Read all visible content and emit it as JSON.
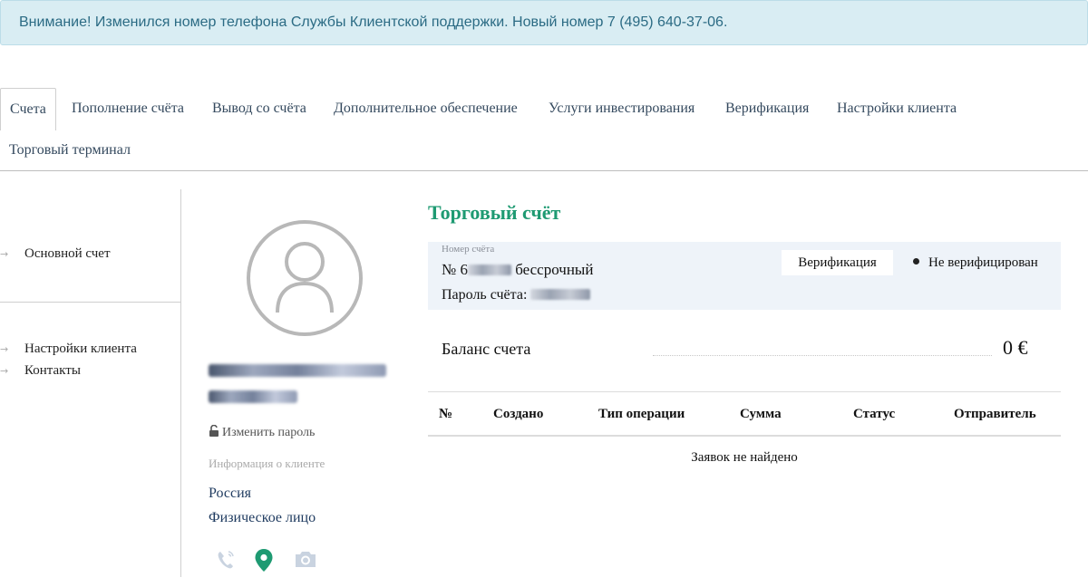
{
  "alert": {
    "text": "Внимание! Изменился номер телефона Службы Клиентской поддержки. Новый номер 7 (495) 640-37-06."
  },
  "tabs": [
    {
      "label": "Счета",
      "active": true
    },
    {
      "label": "Пополнение счёта"
    },
    {
      "label": "Вывод со счёта"
    },
    {
      "label": "Дополнительное обеспечение"
    },
    {
      "label": "Услуги инвестирования"
    },
    {
      "label": "Верификация"
    },
    {
      "label": "Настройки клиента"
    },
    {
      "label": "Торговый терминал"
    }
  ],
  "sidebar": {
    "items": [
      {
        "label": "Основной счет"
      },
      {
        "label": "Настройки клиента"
      },
      {
        "label": "Контакты"
      }
    ]
  },
  "profile": {
    "change_password": "Изменить пароль",
    "info_label": "Информация о клиенте",
    "country": "Россия",
    "client_type": "Физическое лицо",
    "icons": [
      "phone-icon",
      "location-pin-icon",
      "camera-icon"
    ]
  },
  "account": {
    "section_title": "Торговый счёт",
    "number_label": "Номер счёта",
    "number_prefix": "№ 6",
    "number_suffix": "бессрочный",
    "password_label": "Пароль счёта:",
    "verify_button": "Верификация",
    "verify_status": "Не верифицирован",
    "balance_label": "Баланс счета",
    "balance_value": "0 €"
  },
  "table": {
    "headers": [
      "№",
      "Создано",
      "Тип операции",
      "Сумма",
      "Статус",
      "Отправитель"
    ],
    "empty_text": "Заявок не найдено"
  },
  "colors": {
    "alert_bg": "#d9edf3",
    "alert_text": "#2b6b84",
    "accent_green": "#1e9a72",
    "link_blue": "#1e3a5f",
    "account_box_bg": "#eef3f9"
  }
}
